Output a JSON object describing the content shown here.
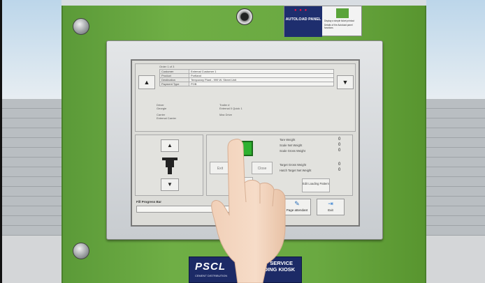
{
  "autoload": {
    "title": "AUTOLOAD PANEL",
    "info_1": "Display a simple ticket printout",
    "info_2": "Details of the Autoload panel functions"
  },
  "screen": {
    "order_label": "Order 1 of 3",
    "fields": [
      {
        "key": "Customer",
        "value": "External Customer 1"
      },
      {
        "key": "Product",
        "value": "Portland"
      },
      {
        "key": "Destination",
        "value": "Temporary Plant - 999 W. Street Unit"
      },
      {
        "key": "Payment Type",
        "value": "POB"
      }
    ],
    "driver_label": "Driver",
    "driver_value": "Georgie",
    "carrier_label": "Carrier",
    "carrier_value": "External Carrier",
    "trailer_label": "Trailer #",
    "trailer_value": "External 0 Quick 1",
    "tank_label": "Max Drive",
    "left_btn": "Exit",
    "right_btn": "Close",
    "weights": [
      {
        "label": "Tare Weight",
        "value": "0"
      },
      {
        "label": "Scale Net Weight",
        "value": "0"
      },
      {
        "label": "Scale Gross Weight",
        "value": "0"
      },
      {
        "label": "Target Gross Weight",
        "value": "0"
      },
      {
        "label": "Hatch Target Net Weight",
        "value": "0"
      }
    ],
    "edit_btn": "Edit Loading Pattern",
    "progress_label": "Fill Progress Bar",
    "progress": 0,
    "page_attendant": "Page attendant",
    "exit": "Exit"
  },
  "plate": {
    "logo": "PSCL",
    "sub": "CEMENT DISTRIBUTION",
    "kiosk": "SELF SERVICE LOADING KIOSK"
  },
  "colors": {
    "kiosk_green": "#6aa941",
    "start_button": "#2fb12f",
    "plate_navy": "#1c2a66"
  }
}
